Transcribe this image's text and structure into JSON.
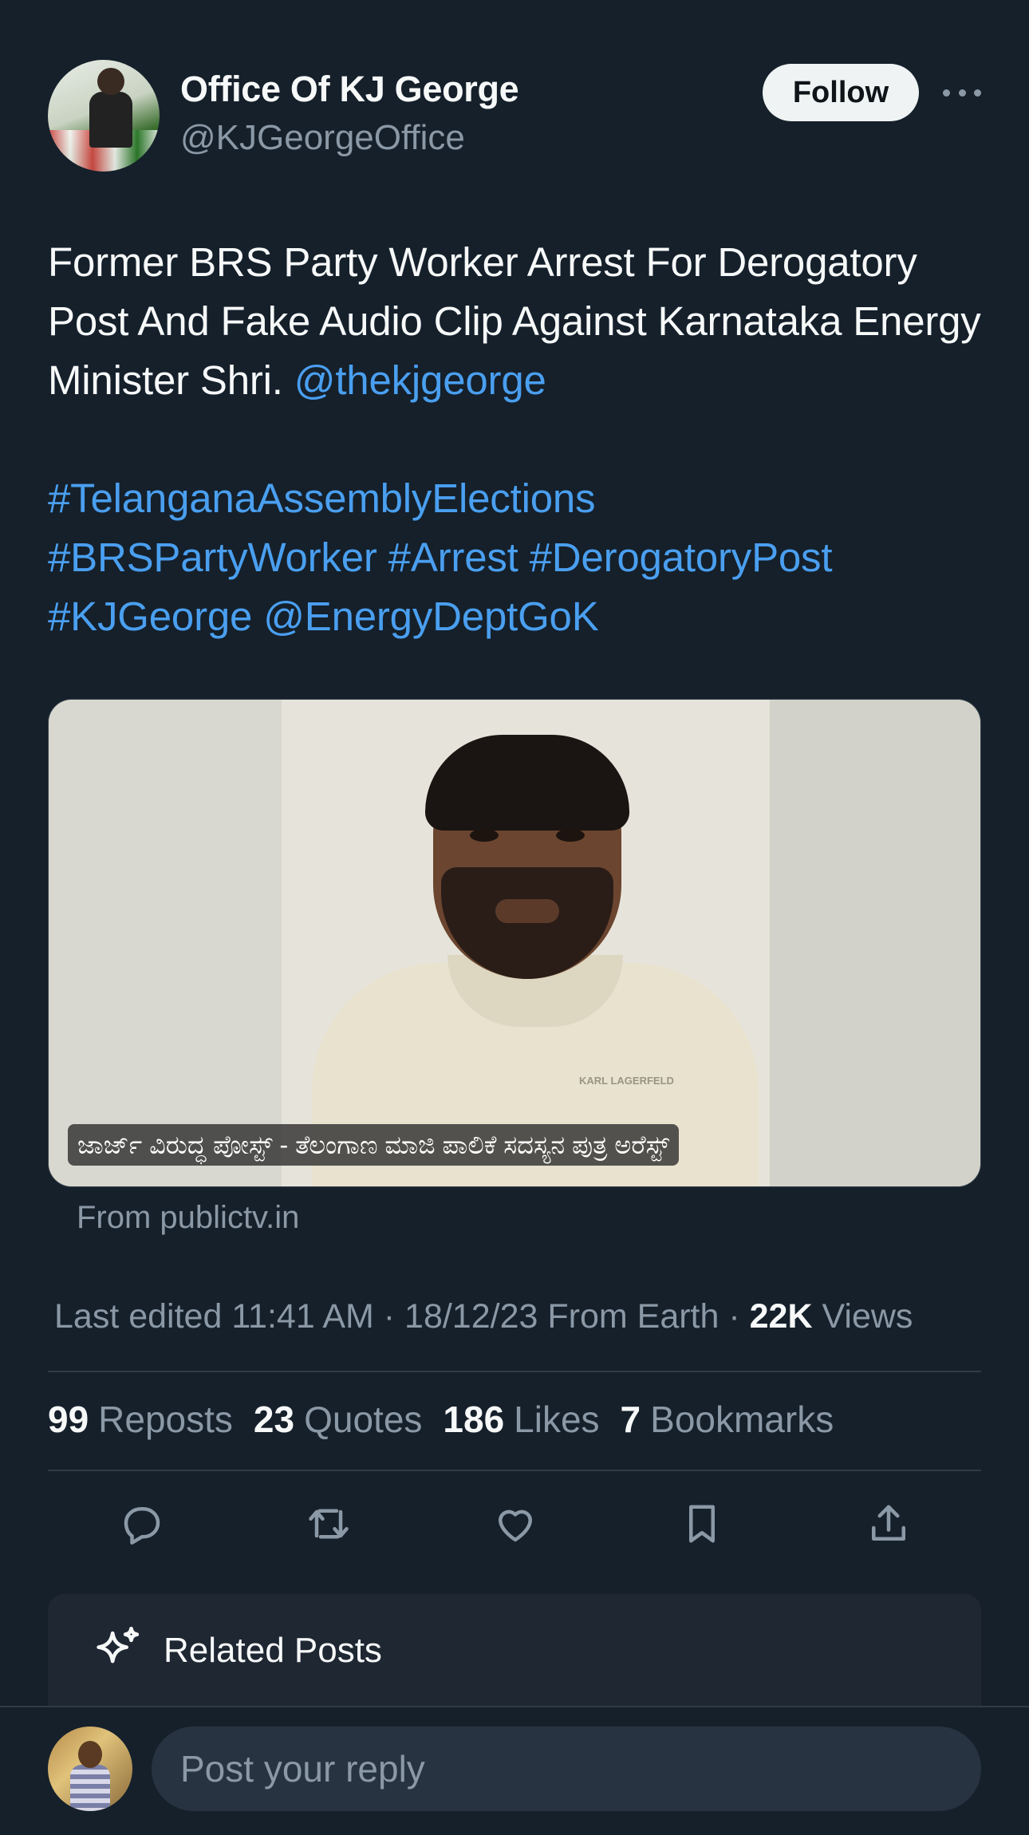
{
  "author": {
    "name": "Office Of KJ George",
    "handle": "@KJGeorgeOffice",
    "follow_label": "Follow"
  },
  "tweet": {
    "text_plain": "Former BRS Party Worker Arrest For Derogatory Post And Fake Audio Clip Against Karnataka Energy Minister Shri.",
    "mention_1": "@thekjgeorge",
    "hashtag_1": "#TelanganaAssemblyElections",
    "hashtag_2": "#BRSPartyWorker",
    "hashtag_3": "#Arrest",
    "hashtag_4": "#DerogatoryPost",
    "hashtag_5": "#KJGeorge",
    "mention_2": "@EnergyDeptGoK"
  },
  "media": {
    "caption": "ಜಾರ್ಜ್ ವಿರುದ್ಧ ಪೋಸ್ಟ್ - ತೆಲಂಗಾಣ ಮಾಜಿ ಪಾಲಿಕೆ ಸದಸ್ಯನ ಪುತ್ರ ಅರೆಸ್ಟ್",
    "shirt_logo": "KARL LAGERFELD",
    "source": "From publictv.in"
  },
  "meta": {
    "edited": "Last edited 11:41 AM · 18/12/23",
    "origin": "From Earth ·",
    "views_count": "22K",
    "views_label": "Views"
  },
  "stats": [
    {
      "num": "99",
      "label": "Reposts"
    },
    {
      "num": "23",
      "label": "Quotes"
    },
    {
      "num": "186",
      "label": "Likes"
    },
    {
      "num": "7",
      "label": "Bookmarks"
    }
  ],
  "actions": {
    "icons": [
      "reply-icon",
      "repost-icon",
      "like-icon",
      "bookmark-icon",
      "share-icon"
    ]
  },
  "related": {
    "label": "Related Posts"
  },
  "reply": {
    "placeholder": "Post your reply"
  },
  "colors": {
    "background": "#15202b",
    "link": "#4a9ff0",
    "muted": "#8b98a5",
    "text": "#f7f9f9"
  }
}
